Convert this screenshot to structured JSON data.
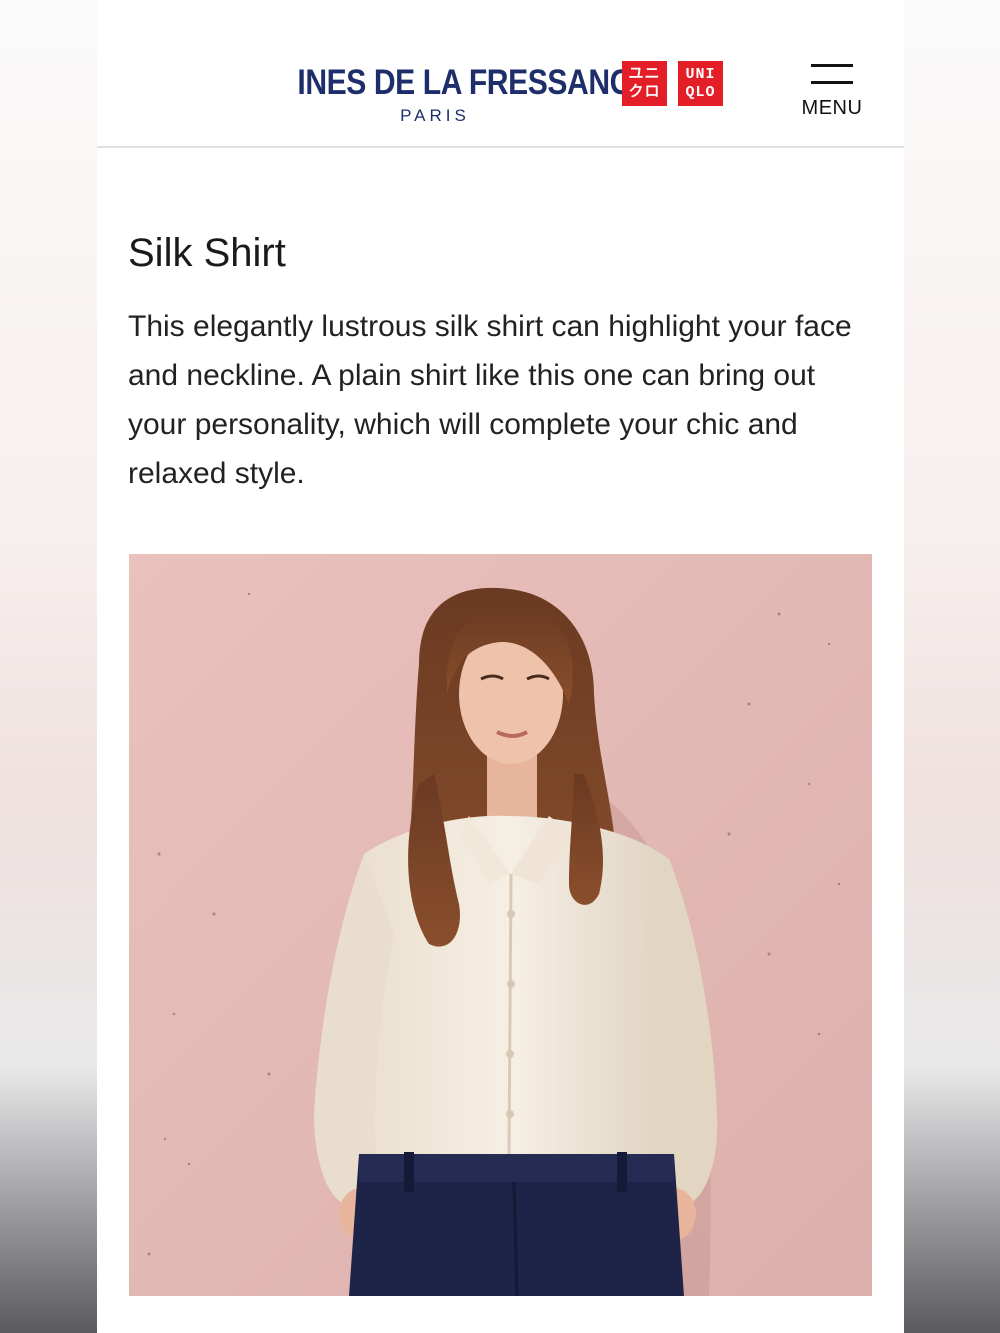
{
  "header": {
    "brand_name": "INES DE LA FRESSANGE",
    "brand_city": "PARIS",
    "uniqlo_katakana_line1": "ユニ",
    "uniqlo_katakana_line2": "クロ",
    "uniqlo_line1": "UNI",
    "uniqlo_line2": "QLO",
    "menu_label": "MENU",
    "menu_icon": "hamburger-icon"
  },
  "product": {
    "title": "Silk Shirt",
    "description": "This elegantly lustrous silk shirt can highlight your face and neckline. A plain shirt like this one can bring out your personality, which will complete your chic and relaxed style."
  },
  "colors": {
    "brand_navy": "#1d2e6b",
    "uniqlo_red": "#e41e26",
    "image_background_pink": "#e7bdb9"
  }
}
